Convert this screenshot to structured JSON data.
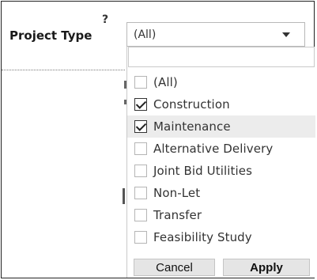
{
  "filter": {
    "help_mark": "?",
    "label": "Project Type",
    "selected_value": "(All)",
    "search": {
      "value": "",
      "placeholder": ""
    },
    "options": [
      {
        "label": "(All)",
        "checked": false
      },
      {
        "label": "Construction",
        "checked": true
      },
      {
        "label": "Maintenance",
        "checked": true
      },
      {
        "label": "Alternative Delivery",
        "checked": false
      },
      {
        "label": "Joint Bid Utilities",
        "checked": false
      },
      {
        "label": "Non-Let",
        "checked": false
      },
      {
        "label": "Transfer",
        "checked": false
      },
      {
        "label": "Feasibility Study",
        "checked": false
      }
    ],
    "buttons": {
      "cancel": "Cancel",
      "apply": "Apply"
    },
    "icons": {
      "dropdown": "chevron-down-icon",
      "check": "checkmark-icon"
    }
  }
}
